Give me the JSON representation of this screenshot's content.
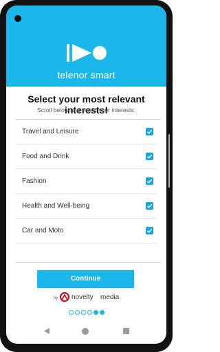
{
  "brand": {
    "name": "telenor smart",
    "color": "#1ab7ea"
  },
  "heading": {
    "title_line1": "Select your most relevant",
    "title_line2": "interests!",
    "subtitle": "Scroll below and select your interests:"
  },
  "interests": [
    {
      "label": "Travel and Leisure",
      "checked": true
    },
    {
      "label": "Food and Drink",
      "checked": true
    },
    {
      "label": "Fashion",
      "checked": true
    },
    {
      "label": "Health and Well-being",
      "checked": true
    },
    {
      "label": "Car and Moto",
      "checked": true
    }
  ],
  "actions": {
    "continue_label": "Continue"
  },
  "footer": {
    "by": "by",
    "partner_part1": "novelty",
    "partner_part2": "media"
  },
  "pager": {
    "total": 6,
    "current": 5
  },
  "icons": {
    "logo": "telenor-smart-logo",
    "checkbox": "check-icon",
    "back": "back-triangle-icon",
    "home": "home-circle-icon",
    "recent": "recent-square-icon"
  }
}
